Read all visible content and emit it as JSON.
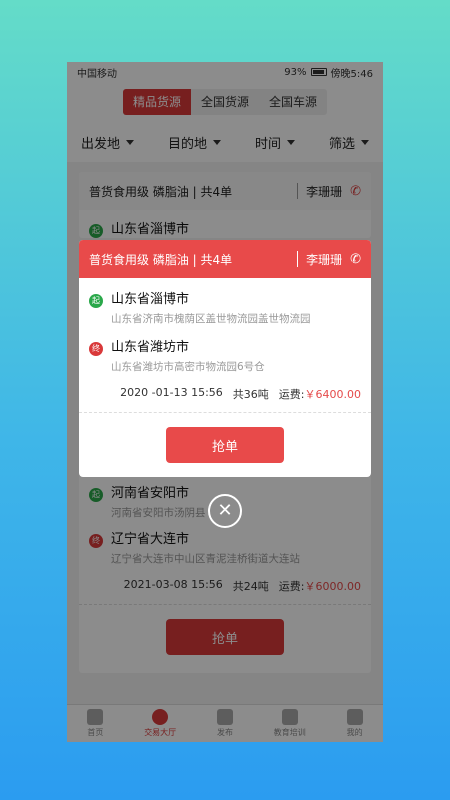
{
  "status_bar": {
    "carrier": "中国移动",
    "battery": "93%",
    "time": "傍晚5:46"
  },
  "tabs": [
    {
      "label": "精品货源",
      "active": true
    },
    {
      "label": "全国货源",
      "active": false
    },
    {
      "label": "全国车源",
      "active": false
    }
  ],
  "filters": [
    "出发地",
    "目的地",
    "时间",
    "筛选"
  ],
  "cards": [
    {
      "title": "普货食用级  磷脂油 | 共4单",
      "contact": "李珊珊",
      "stops": [
        {
          "type": "起",
          "city": "山东省淄博市",
          "address": "山东省济南市槐荫区盖世物流园盖世物流园"
        },
        {
          "type": "终",
          "city": "山东省潍坊市",
          "address": "山东省潍坊市高密市物流园6号仓"
        }
      ],
      "date": "2020 -01-13 15:56",
      "weight": "共36吨",
      "freight_label": "运费:",
      "price": "￥6400.00",
      "button": "抢单"
    },
    {
      "title": "",
      "contact": "",
      "stops": [
        {
          "type": "起",
          "city": "河南省安阳市",
          "address": "河南省安阳市汤阴县"
        },
        {
          "type": "终",
          "city": "辽宁省大连市",
          "address": "辽宁省大连市中山区青泥洼桥街道大连站"
        }
      ],
      "date": "2021-03-08 15:56",
      "weight": "共24吨",
      "freight_label": "运费:",
      "price": "￥6000.00",
      "button": "抢单"
    }
  ],
  "modal": {
    "title": "普货食用级  磷脂油 | 共4单",
    "contact": "李珊珊",
    "start_type": "起",
    "start_city": "山东省淄博市",
    "start_address": "山东省济南市槐荫区盖世物流园盖世物流园",
    "end_type": "终",
    "end_city": "山东省潍坊市",
    "end_address": "山东省潍坊市高密市物流园6号仓",
    "date": "2020 -01-13 15:56",
    "weight": "共36吨",
    "freight_label": "运费:",
    "price": "￥6400.00",
    "button": "抢单"
  },
  "bottom_nav": [
    {
      "label": "首页",
      "icon": "home-icon",
      "active": false
    },
    {
      "label": "交易大厅",
      "icon": "bulb-icon",
      "active": true
    },
    {
      "label": "发布",
      "icon": "plus-icon",
      "active": false
    },
    {
      "label": "教育培训",
      "icon": "book-icon",
      "active": false
    },
    {
      "label": "我的",
      "icon": "user-icon",
      "active": false
    }
  ],
  "colors": {
    "accent": "#d9393a",
    "modal_header": "#e84a4a",
    "start": "#2aa84a"
  }
}
